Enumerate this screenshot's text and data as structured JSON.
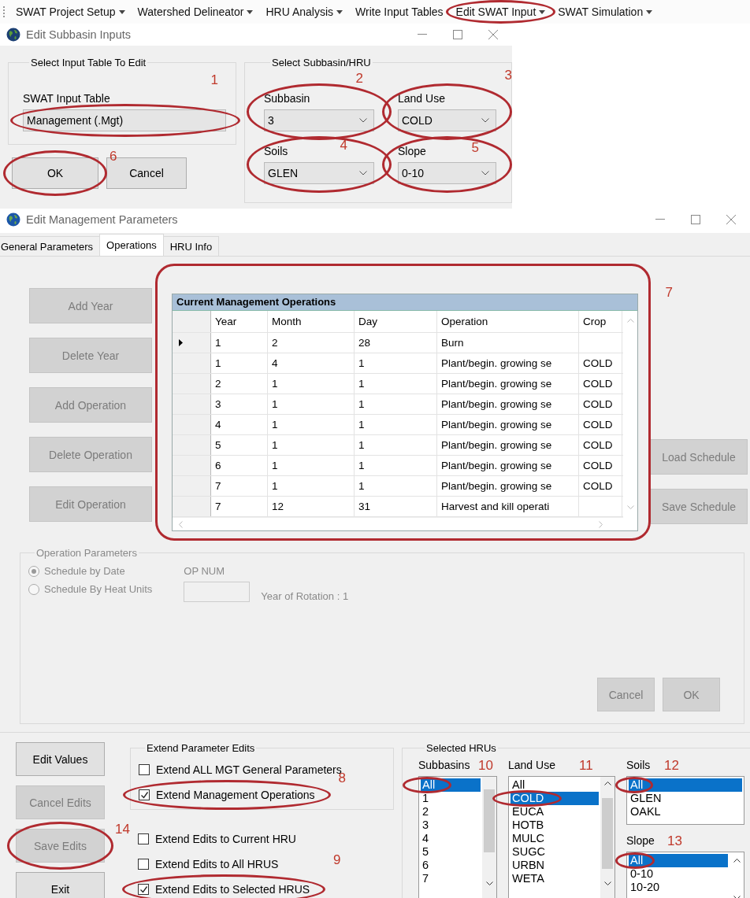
{
  "menu_bar": {
    "items": [
      {
        "label": "SWAT Project Setup",
        "has_menu": true
      },
      {
        "label": "Watershed Delineator",
        "has_menu": true
      },
      {
        "label": "HRU Analysis",
        "has_menu": true
      },
      {
        "label": "Write Input Tables",
        "has_menu": false
      },
      {
        "label": "Edit SWAT Input",
        "has_menu": true
      },
      {
        "label": "SWAT Simulation",
        "has_menu": true
      }
    ]
  },
  "subbasin_dialog": {
    "title": "Edit Subbasin Inputs",
    "input_table_group": {
      "title": "Select Input Table To Edit",
      "label": "SWAT Input Table",
      "value": "Management (.Mgt)"
    },
    "hru_group": {
      "title": "Select Subbasin/HRU",
      "fields": [
        {
          "label": "Subbasin",
          "value": "3"
        },
        {
          "label": "Land Use",
          "value": "COLD"
        },
        {
          "label": "Soils",
          "value": "GLEN"
        },
        {
          "label": "Slope",
          "value": "0-10"
        }
      ]
    },
    "buttons": [
      {
        "label": "OK",
        "disabled": false
      },
      {
        "label": "Cancel",
        "disabled": false
      }
    ]
  },
  "management_window": {
    "title": "Edit Management Parameters",
    "tabs": [
      {
        "label": "General Parameters",
        "selected": false
      },
      {
        "label": "Operations",
        "selected": true
      },
      {
        "label": "HRU Info",
        "selected": false
      }
    ],
    "left_buttons": [
      {
        "label": "Add Year",
        "disabled": true
      },
      {
        "label": "Delete Year",
        "disabled": true
      },
      {
        "label": "Add Operation",
        "disabled": true
      },
      {
        "label": "Delete Operation",
        "disabled": true
      },
      {
        "label": "Edit Operation",
        "disabled": true
      }
    ],
    "table": {
      "title": "Current Management Operations",
      "columns": [
        "Year",
        "Month",
        "Day",
        "Operation",
        "Crop"
      ],
      "rows": [
        {
          "current": true,
          "cells": [
            "1",
            "2",
            "28",
            "Burn"
          ]
        },
        {
          "current": false,
          "cells": [
            "1",
            "4",
            "1",
            "Plant/begin. growing se",
            "COLD"
          ]
        },
        {
          "current": false,
          "cells": [
            "2",
            "1",
            "1",
            "Plant/begin. growing se",
            "COLD"
          ]
        },
        {
          "current": false,
          "cells": [
            "3",
            "1",
            "1",
            "Plant/begin. growing se",
            "COLD"
          ]
        },
        {
          "current": false,
          "cells": [
            "4",
            "1",
            "1",
            "Plant/begin. growing se",
            "COLD"
          ]
        },
        {
          "current": false,
          "cells": [
            "5",
            "1",
            "1",
            "Plant/begin. growing se",
            "COLD"
          ]
        },
        {
          "current": false,
          "cells": [
            "6",
            "1",
            "1",
            "Plant/begin. growing se",
            "COLD"
          ]
        },
        {
          "current": false,
          "cells": [
            "7",
            "1",
            "1",
            "Plant/begin. growing se",
            "COLD"
          ]
        },
        {
          "current": false,
          "cells": [
            "7",
            "12",
            "31",
            "Harvest and kill operati"
          ]
        }
      ]
    },
    "right_buttons": [
      {
        "label": "Load Schedule",
        "disabled": true
      },
      {
        "label": "Save Schedule",
        "disabled": true
      }
    ],
    "operation_parameters": {
      "title": "Operation Parameters",
      "radios": [
        {
          "label": "Schedule by Date",
          "selected": true
        },
        {
          "label": "Schedule By Heat Units",
          "selected": false
        }
      ],
      "op_num_label": "OP NUM",
      "year_of_rotation": "Year of Rotation : 1",
      "buttons": [
        {
          "label": "Cancel",
          "disabled": true
        },
        {
          "label": "OK",
          "disabled": true
        }
      ]
    },
    "action_buttons": [
      {
        "label": "Edit Values",
        "disabled": false
      },
      {
        "label": "Cancel Edits",
        "disabled": true
      },
      {
        "label": "Save Edits",
        "disabled": true
      },
      {
        "label": "Exit",
        "disabled": false
      }
    ],
    "extend_group": {
      "title": "Extend Parameter Edits",
      "checkboxes": [
        {
          "label": "Extend ALL MGT General Parameters",
          "checked": false
        },
        {
          "label": "Extend Management Operations",
          "checked": true
        }
      ]
    },
    "extend_checkboxes": [
      {
        "label": "Extend Edits to Current HRU",
        "checked": false
      },
      {
        "label": "Extend Edits to All HRUS",
        "checked": false
      },
      {
        "label": "Extend Edits to Selected HRUS",
        "checked": true
      }
    ],
    "selected_hrus": {
      "title": "Selected HRUs",
      "lists": [
        {
          "label": "Subbasins",
          "items": [
            {
              "label": "All",
              "selected": true
            },
            {
              "label": "1",
              "selected": false
            },
            {
              "label": "2",
              "selected": false
            },
            {
              "label": "3",
              "selected": false
            },
            {
              "label": "4",
              "selected": false
            },
            {
              "label": "5",
              "selected": false
            },
            {
              "label": "6",
              "selected": false
            },
            {
              "label": "7",
              "selected": false
            }
          ]
        },
        {
          "label": "Land Use",
          "items": [
            {
              "label": "All",
              "selected": false
            },
            {
              "label": "COLD",
              "selected": true
            },
            {
              "label": "EUCA",
              "selected": false
            },
            {
              "label": "HOTB",
              "selected": false
            },
            {
              "label": "MULC",
              "selected": false
            },
            {
              "label": "SUGC",
              "selected": false
            },
            {
              "label": "URBN",
              "selected": false
            },
            {
              "label": "WETA",
              "selected": false
            }
          ]
        },
        {
          "label": "Soils",
          "items": [
            {
              "label": "All",
              "selected": true
            },
            {
              "label": "GLEN",
              "selected": false
            },
            {
              "label": "OAKL",
              "selected": false
            }
          ]
        },
        {
          "label": "Slope",
          "items": [
            {
              "label": "All",
              "selected": true
            },
            {
              "label": "0-10",
              "selected": false
            },
            {
              "label": "10-20",
              "selected": false
            }
          ]
        }
      ]
    }
  },
  "annotations": [
    {
      "kind": "ellipse"
    },
    {
      "kind": "ellipse",
      "number": "1"
    },
    {
      "kind": "ellipse",
      "number": "2"
    },
    {
      "kind": "ellipse",
      "number": "3"
    },
    {
      "kind": "ellipse",
      "number": "4"
    },
    {
      "kind": "ellipse",
      "number": "5"
    },
    {
      "kind": "ellipse",
      "number": "6"
    },
    {
      "kind": "box",
      "number": "7"
    },
    {
      "kind": "ellipse",
      "number": "8"
    },
    {
      "kind": "ellipse",
      "number": "9"
    },
    {
      "kind": "ellipse",
      "number": "10"
    },
    {
      "kind": "ellipse",
      "number": "11"
    },
    {
      "kind": "ellipse",
      "number": "12"
    },
    {
      "kind": "ellipse",
      "number": "13"
    },
    {
      "kind": "ellipse",
      "number": "14"
    }
  ]
}
